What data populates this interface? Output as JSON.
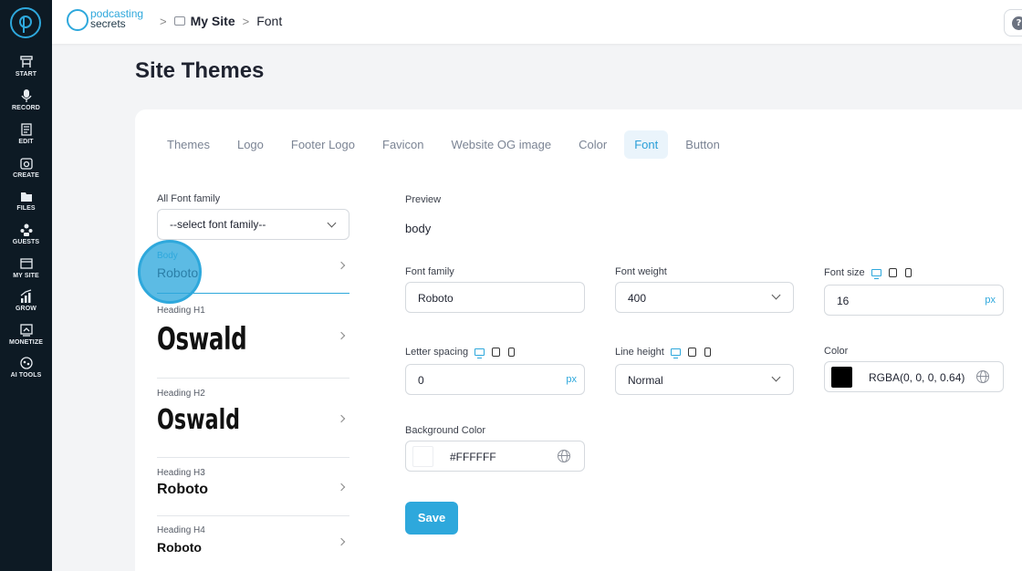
{
  "sidebar": {
    "items": [
      {
        "label": "START",
        "icon": "start-icon"
      },
      {
        "label": "RECORD",
        "icon": "microphone-icon"
      },
      {
        "label": "EDIT",
        "icon": "edit-icon"
      },
      {
        "label": "CREATE",
        "icon": "create-icon"
      },
      {
        "label": "FILES",
        "icon": "files-icon"
      },
      {
        "label": "GUESTS",
        "icon": "guests-icon"
      },
      {
        "label": "MY SITE",
        "icon": "my-site-icon"
      },
      {
        "label": "GROW",
        "icon": "grow-icon"
      },
      {
        "label": "MONETIZE",
        "icon": "monetize-icon"
      },
      {
        "label": "AI TOOLS",
        "icon": "ai-tools-icon"
      }
    ]
  },
  "header": {
    "brand_line1": "podcasting",
    "brand_line2": "secrets",
    "breadcrumb": [
      "My Site",
      "Font"
    ],
    "help_label": "?"
  },
  "page": {
    "title": "Site Themes"
  },
  "tabs": [
    {
      "label": "Themes",
      "active": false
    },
    {
      "label": "Logo",
      "active": false
    },
    {
      "label": "Footer Logo",
      "active": false
    },
    {
      "label": "Favicon",
      "active": false
    },
    {
      "label": "Website OG image",
      "active": false
    },
    {
      "label": "Color",
      "active": false
    },
    {
      "label": "Font",
      "active": true
    },
    {
      "label": "Button",
      "active": false
    }
  ],
  "font_family": {
    "label": "All Font family",
    "value": "--select font family--"
  },
  "font_items": [
    {
      "category": "Body",
      "font": "Roboto",
      "selected": true
    },
    {
      "category": "Heading H1",
      "font": "Oswald"
    },
    {
      "category": "Heading H2",
      "font": "Oswald"
    },
    {
      "category": "Heading H3",
      "font": "Roboto"
    },
    {
      "category": "Heading H4",
      "font": "Roboto"
    }
  ],
  "preview": {
    "label": "Preview",
    "text": "body"
  },
  "form": {
    "font_family_label": "Font family",
    "font_family_value": "Roboto",
    "font_weight_label": "Font weight",
    "font_weight_value": "400",
    "font_size_label": "Font size",
    "font_size_value": "16",
    "font_size_unit": "px",
    "letter_spacing_label": "Letter spacing",
    "letter_spacing_value": "0",
    "letter_spacing_unit": "px",
    "line_height_label": "Line height",
    "line_height_value": "Normal",
    "color_label": "Color",
    "color_value": "RGBA(0, 0, 0, 0.64)",
    "color_swatch": "#000000",
    "bg_color_label": "Background Color",
    "bg_color_value": "#FFFFFF",
    "bg_color_swatch": "#FFFFFF",
    "save_label": "Save"
  },
  "colors": {
    "accent": "#2ea8dc",
    "sidebar": "#0d1a24"
  }
}
